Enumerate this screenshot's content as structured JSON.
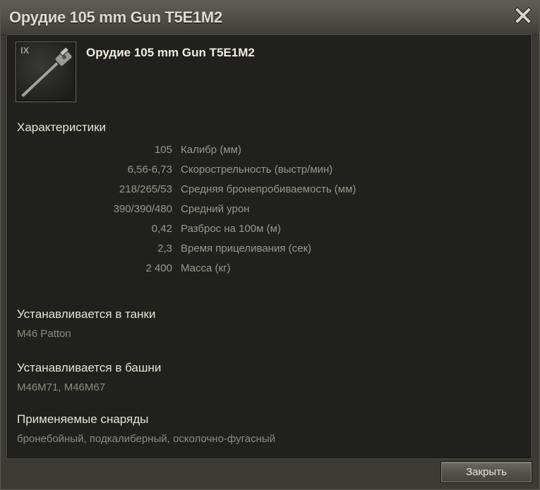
{
  "window": {
    "title": "Орудие 105 mm Gun T5E1M2",
    "close_icon": "close-icon"
  },
  "module": {
    "tier": "IX",
    "name": "Орудие 105 mm Gun T5E1M2",
    "image_icon": "gun-icon"
  },
  "characteristics": {
    "title": "Характеристики",
    "rows": [
      {
        "value": "105",
        "label": "Калибр (мм)"
      },
      {
        "value": "6,56-6,73",
        "label": "Скорострельность (выстр/мин)"
      },
      {
        "value": "218/265/53",
        "label": "Средняя бронепробиваемость (мм)"
      },
      {
        "value": "390/390/480",
        "label": "Средний урон"
      },
      {
        "value": "0,42",
        "label": "Разброс на 100м (м)"
      },
      {
        "value": "2,3",
        "label": "Время прицеливания (сек)"
      },
      {
        "value": "2 400",
        "label": "Масса (кг)"
      }
    ]
  },
  "tanks": {
    "title": "Устанавливается в танки",
    "text": "M46 Patton"
  },
  "turrets": {
    "title": "Устанавливается в башни",
    "text": "M46M71, M46M67"
  },
  "shells": {
    "title": "Применяемые снаряды",
    "text": "бронебойный, подкалиберный, осколочно-фугасный"
  },
  "footer": {
    "close_label": "Закрыть"
  },
  "colors": {
    "title_bar": "#4d4c45",
    "content_bg": "#20201c",
    "heading_text": "#e6e4d4",
    "muted_text": "#8e8c80"
  }
}
